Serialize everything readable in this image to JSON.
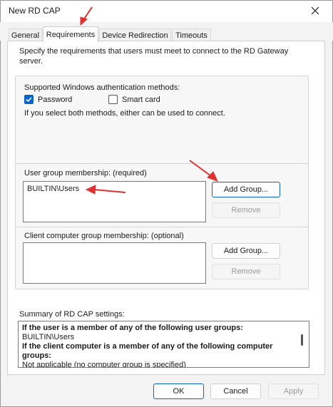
{
  "window": {
    "title": "New RD CAP"
  },
  "tabs": [
    {
      "label": "General"
    },
    {
      "label": "Requirements"
    },
    {
      "label": "Device Redirection"
    },
    {
      "label": "Timeouts"
    }
  ],
  "requirements": {
    "intro": "Specify the requirements that users must meet to connect to the RD Gateway",
    "intro_line2": "server.",
    "auth": {
      "label": "Supported Windows authentication methods:",
      "password_label": "Password",
      "password_checked": true,
      "smartcard_label": "Smart card",
      "smartcard_checked": false,
      "note": "If you select both methods, either can be used to connect."
    },
    "user_groups": {
      "label": "User group membership: (required)",
      "items": [
        "BUILTIN\\Users"
      ],
      "add_label": "Add Group...",
      "remove_label": "Remove"
    },
    "client_groups": {
      "label": "Client computer group membership: (optional)",
      "items": [],
      "add_label": "Add Group...",
      "remove_label": "Remove"
    },
    "summary": {
      "label": "Summary of RD CAP settings:",
      "lines": [
        "If the user is a member of any of the following user groups:",
        "BUILTIN\\Users",
        "If the client computer is a member of any of the following computer",
        "groups:",
        "Not applicable (no computer group is specified)"
      ]
    }
  },
  "footer": {
    "ok_label": "OK",
    "cancel_label": "Cancel",
    "apply_label": "Apply"
  },
  "annotation_color": "#e03030"
}
